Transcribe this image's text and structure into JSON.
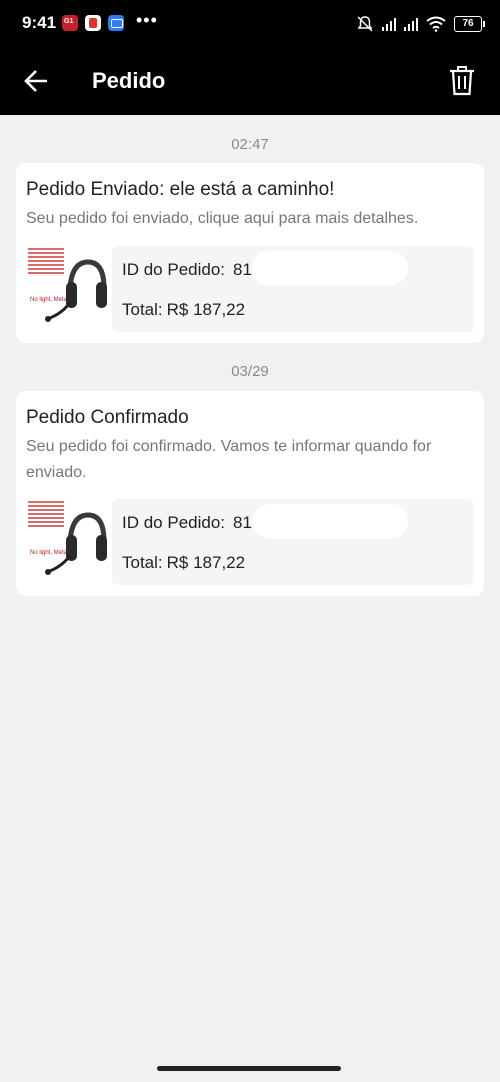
{
  "status_bar": {
    "time": "9:41",
    "dots": "•••",
    "battery": "76"
  },
  "header": {
    "title": "Pedido",
    "back_icon": "arrow-left-icon",
    "trash_icon": "trash-icon"
  },
  "notifications": [
    {
      "timestamp": "02:47",
      "title": "Pedido Enviado: ele está a caminho!",
      "message": "Seu pedido foi enviado, clique aqui para mais detalhes.",
      "order_id_label": "ID do Pedido:",
      "order_id_value": "81",
      "total_label": "Total:",
      "total_value": "R$ 187,22",
      "thumb_caption": "No light, Metal"
    },
    {
      "timestamp": "03/29",
      "title": "Pedido Confirmado",
      "message": "Seu pedido foi confirmado. Vamos te informar quando for enviado.",
      "order_id_label": "ID do Pedido:",
      "order_id_value": "81",
      "total_label": "Total:",
      "total_value": "R$ 187,22",
      "thumb_caption": "No light, Metal"
    }
  ]
}
